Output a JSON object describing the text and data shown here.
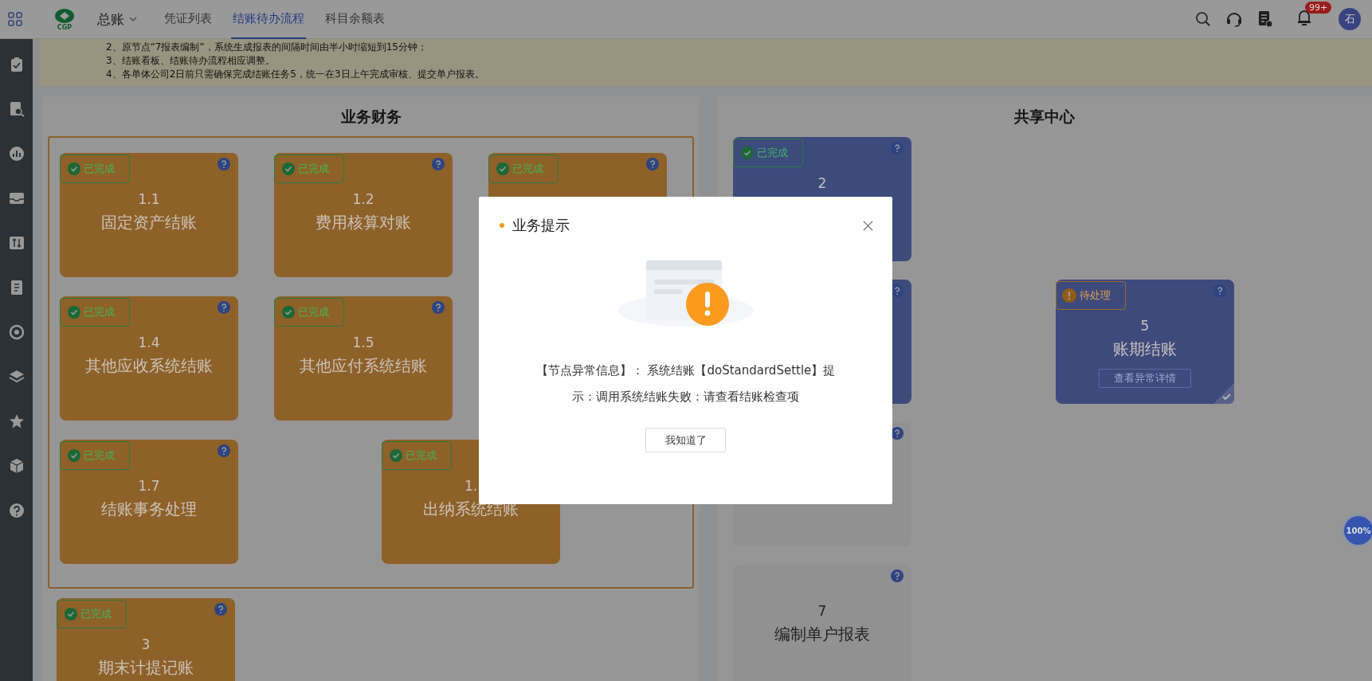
{
  "nav": {
    "logo_text": "CGP",
    "module": "总账",
    "tabs": [
      {
        "label": "凭证列表",
        "selected": false
      },
      {
        "label": "结账待办流程",
        "selected": true
      },
      {
        "label": "科目余额表",
        "selected": false
      }
    ],
    "notification_badge": "99+",
    "avatar": "石"
  },
  "notice": {
    "lines": [
      "2、原节点“7报表编制”，系统生成报表的间隔时间由半小时缩短到15分钟；",
      "3、结账看板、结账待办流程相应调整。",
      "4、各单体公司2日前只需确保完成结账任务5，统一在3日上午完成审核、提交单户报表。"
    ]
  },
  "business": {
    "title": "业务财务",
    "group_rows": [
      [
        {
          "status": {
            "kind": "done",
            "label": "已完成"
          },
          "number": "1.1",
          "title": "固定资产结账",
          "color": "#8e6128",
          "checked": false
        },
        {
          "status": {
            "kind": "done",
            "label": "已完成"
          },
          "number": "1.2",
          "title": "费用核算对账",
          "color": "#8e6128",
          "checked": false
        },
        {
          "status": {
            "kind": "done",
            "label": "已完成"
          },
          "color": "#8e6128",
          "checked": false
        }
      ],
      [
        {
          "status": {
            "kind": "done",
            "label": "已完成"
          },
          "number": "1.4",
          "title": "其他应收系统结账",
          "color": "#8e6128",
          "checked": false
        },
        {
          "status": {
            "kind": "done",
            "label": "已完成"
          },
          "number": "1.5",
          "title": "其他应付系统结账",
          "color": "#8e6128",
          "checked": false
        }
      ],
      [
        {
          "status": {
            "kind": "done",
            "label": "已完成"
          },
          "number": "1.7",
          "title": "结账事务处理",
          "color": "#8e6128",
          "checked": false
        },
        {
          "status": {
            "kind": "done",
            "label": "已完成"
          },
          "number": "1.",
          "title": "出纳系统结账",
          "color": "#8e6128",
          "checked": false
        }
      ]
    ],
    "extra_cards": [
      {
        "status": {
          "kind": "done",
          "label": "已完成"
        },
        "number": "3",
        "title": "期末计提记账",
        "color": "#8e6128",
        "checked": false
      }
    ]
  },
  "shared": {
    "title": "共享中心",
    "columns": [
      [
        {
          "status": {
            "kind": "done",
            "label": "已完成"
          },
          "number": "2",
          "color": "#3d4a7c",
          "checked": false
        },
        {
          "color": "#3d4a7c",
          "checked": false
        },
        {
          "color": "#919191",
          "checked": false
        },
        {
          "number": "7",
          "title": "编制单户报表",
          "color": "#919191",
          "checked": false
        }
      ],
      [
        {
          "status": {
            "kind": "pending",
            "label": "待处理"
          },
          "number": "5",
          "title": "账期结账",
          "action": "查看异常详情",
          "color": "#3d4a7c",
          "checked": true
        }
      ]
    ]
  },
  "zoom_badge": "100%",
  "modal": {
    "title": "业务提示",
    "message": "【节点异常信息】： 系统结账【doStandardSettle】提示：调用系统结账失败：请查看结账检查项",
    "button": "我知道了"
  }
}
